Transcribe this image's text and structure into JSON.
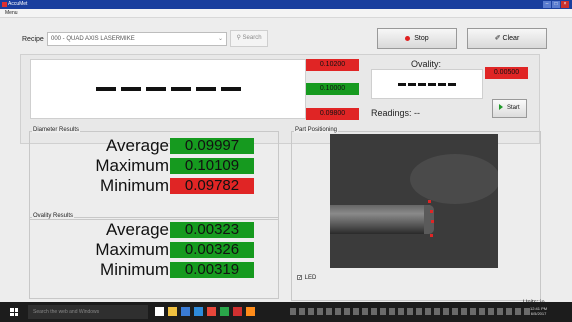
{
  "window": {
    "title": "AccuMet",
    "menu": "Menu"
  },
  "recipe": {
    "label": "Recipe",
    "value": "000 - QUAD AXIS LASERMIKE"
  },
  "toolbar": {
    "search_label": "Search",
    "stop_label": "Stop",
    "clear_label": "Clear"
  },
  "diameter_tolerances": {
    "upper": "0.10200",
    "nominal": "0.10000",
    "lower": "0.09800"
  },
  "ovality": {
    "label": "Ovality:",
    "tolerance": "0.00500"
  },
  "readings": {
    "label": "Readings: --"
  },
  "start_label": "Start",
  "diameter_results": {
    "title": "Diameter Results",
    "rows": [
      {
        "label": "Average",
        "value": "0.09997",
        "status": "green"
      },
      {
        "label": "Maximum",
        "value": "0.10109",
        "status": "green"
      },
      {
        "label": "Minimum",
        "value": "0.09782",
        "status": "red"
      }
    ]
  },
  "ovality_results": {
    "title": "Ovality Results",
    "rows": [
      {
        "label": "Average",
        "value": "0.00323",
        "status": "green"
      },
      {
        "label": "Maximum",
        "value": "0.00326",
        "status": "green"
      },
      {
        "label": "Minimum",
        "value": "0.00319",
        "status": "green"
      }
    ]
  },
  "part_positioning": {
    "title": "Part Positioning",
    "led_label": "LED",
    "led_checked": true
  },
  "units": "Units: in",
  "taskbar": {
    "search_placeholder": "Search the web and Windows",
    "time": "12:41 PM",
    "date": "6/5/2017"
  },
  "colors": {
    "pass": "#169a1f",
    "fail": "#e02525",
    "titlebar": "#1a3f9e"
  }
}
